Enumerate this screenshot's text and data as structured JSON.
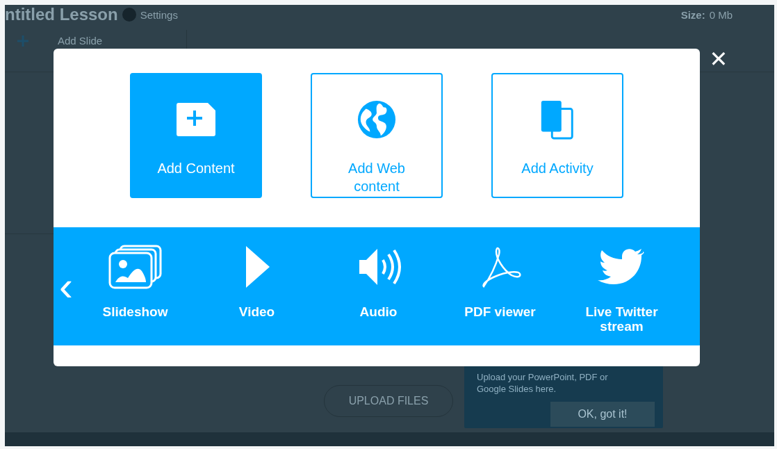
{
  "header": {
    "title": "ntitled Lesson",
    "settings": "Settings",
    "size_label": "Size:",
    "size_value": "0 Mb"
  },
  "toolbar": {
    "add_slide": "Add Slide"
  },
  "upload": {
    "button": "UPLOAD FILES",
    "tooltip": "Upload your PowerPoint, PDF or Google Slides here.",
    "ok": "OK, got it!"
  },
  "dialog": {
    "close": "✕",
    "tiles": [
      {
        "kind": "content",
        "label": "Add Content",
        "selected": true
      },
      {
        "kind": "web",
        "label": "Add Web content",
        "selected": false
      },
      {
        "kind": "activity",
        "label": "Add Activity",
        "selected": false
      }
    ],
    "prev": "‹",
    "items": [
      {
        "kind": "slideshow",
        "label": "Slideshow"
      },
      {
        "kind": "video",
        "label": "Video"
      },
      {
        "kind": "audio",
        "label": "Audio"
      },
      {
        "kind": "pdf",
        "label": "PDF viewer"
      },
      {
        "kind": "twitter",
        "label": "Live Twitter stream"
      }
    ]
  }
}
